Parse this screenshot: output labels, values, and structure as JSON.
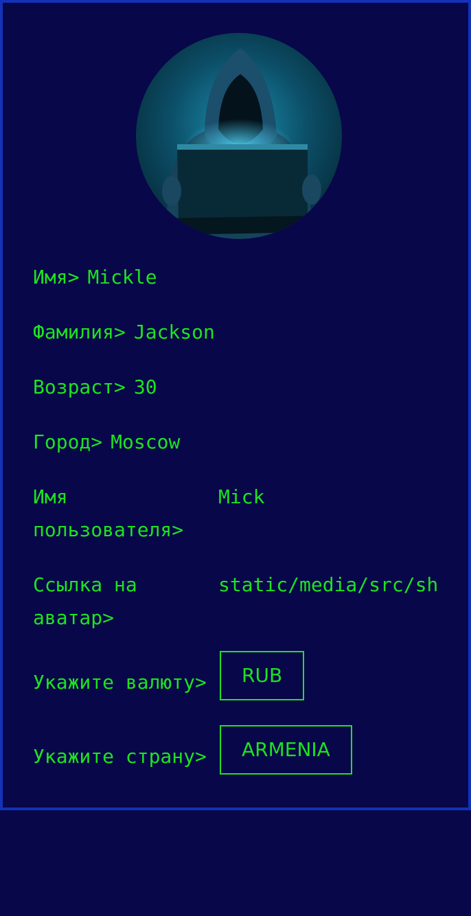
{
  "profile": {
    "avatar_icon": "hooded-hacker-laptop-avatar",
    "first_name_label": "Имя>",
    "first_name_value": "Mickle",
    "last_name_label": "Фамилия>",
    "last_name_value": "Jackson",
    "age_label": "Возраст>",
    "age_value": "30",
    "city_label": "Город>",
    "city_value": "Moscow",
    "username_label": "Имя пользователя>",
    "username_value": "Mick",
    "avatar_link_label": "Ссылка на аватар>",
    "avatar_link_value": "static/media/src/sh",
    "currency_label": "Укажите валюту>",
    "currency_value": "RUB",
    "country_label": "Укажите страну>",
    "country_value": "ARMENIA"
  },
  "colors": {
    "background": "#08074a",
    "border": "#1232b8",
    "text": "#1ee31e"
  }
}
